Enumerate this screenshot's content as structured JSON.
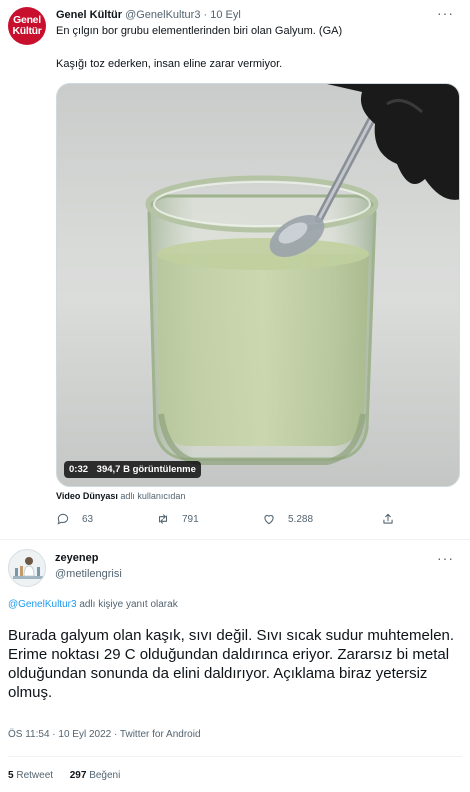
{
  "quoted_tweet": {
    "avatar_text_line1": "Genel",
    "avatar_text_line2": "Kültür",
    "author_name": "Genel Kültür",
    "author_handle": "@GenelKultur3",
    "dot": "·",
    "date": "10 Eyl",
    "text_line1": "En çılgın bor grubu elementlerinden biri olan Galyum. (GA)",
    "text_line2": "Kaşığı toz ederken, insan eline zarar vermiyor.",
    "video": {
      "duration": "0:32",
      "views": "394,7 B görüntülenme"
    },
    "attribution_user": "Video Dünyası",
    "attribution_suffix": "adlı kullanıcıdan",
    "actions": {
      "replies": "63",
      "retweets": "791",
      "likes": "5.288"
    },
    "more_icon": "more-horizontal-icon"
  },
  "reply_tweet": {
    "author_name": "zeyenep",
    "author_handle": "@metilengrisi",
    "reply_to_handle": "@GenelKultur3",
    "reply_to_suffix": "adlı kişiye yanıt olarak",
    "text": "Burada galyum olan kaşık, sıvı değil. Sıvı sıcak sudur muhtemelen. Erime noktası 29 C olduğundan daldırınca eriyor. Zararsız bi metal olduğundan sonunda da elini daldırıyor. Açıklama biraz yetersiz olmuş.",
    "timestamp": "ÖS 11:54 · 10 Eyl 2022 · Twitter for Android",
    "stats": {
      "retweets_count": "5",
      "retweets_label": "Retweet",
      "likes_count": "297",
      "likes_label": "Beğeni"
    }
  },
  "colors": {
    "brand_red": "#c8102e",
    "link_blue": "#1d9bf0",
    "muted_gray": "#536471"
  }
}
